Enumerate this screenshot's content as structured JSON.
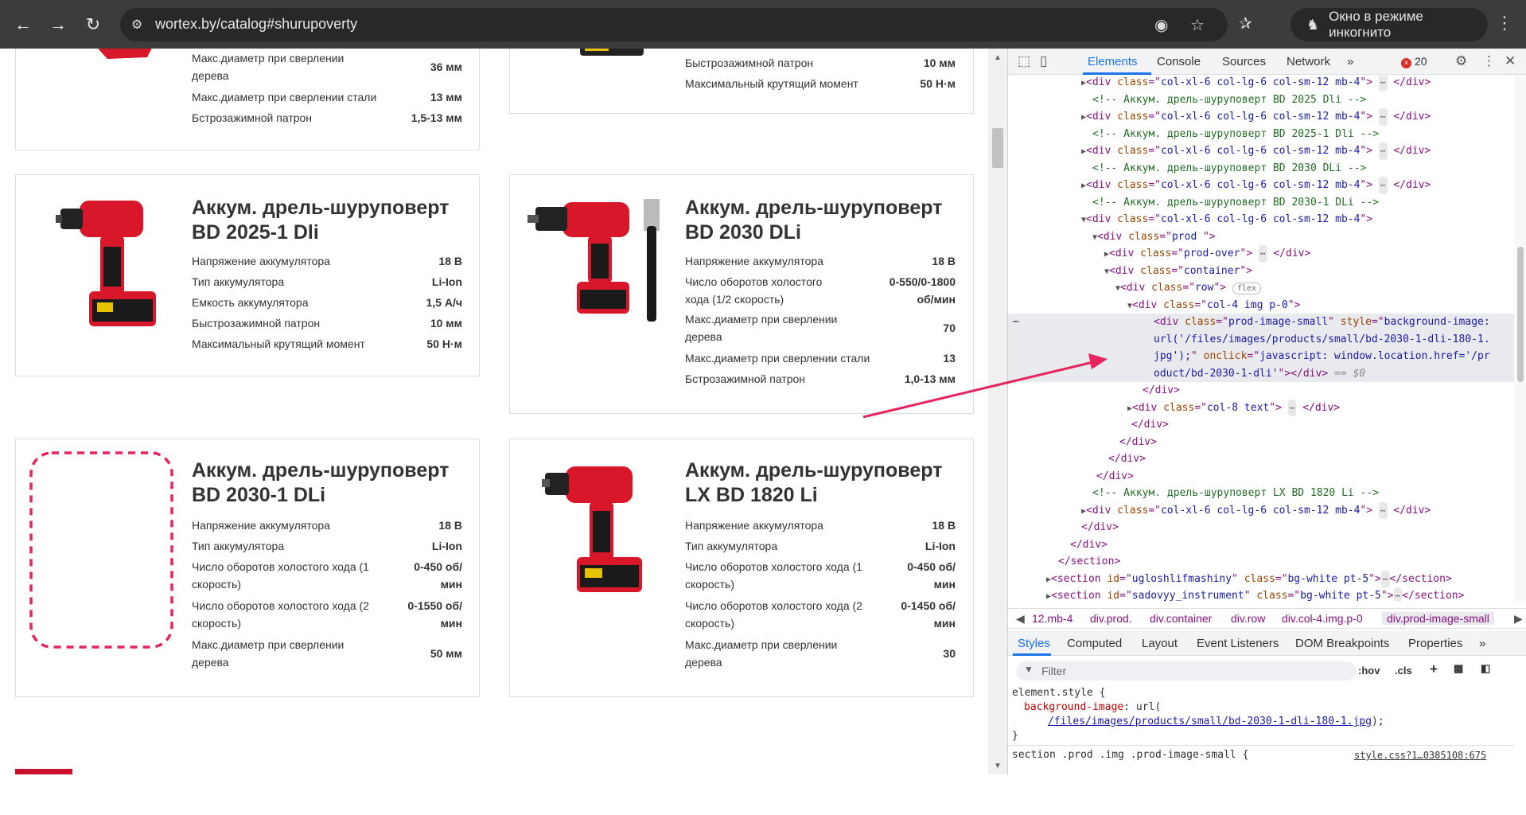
{
  "browser": {
    "url": "wortex.by/catalog#shurupoverty",
    "incognito_label": "Окно в режиме инкогнито",
    "error_count": "20"
  },
  "products": {
    "top_left": {
      "specs": [
        {
          "k": "Макс.диаметр при сверлении дерева",
          "v": "36 мм"
        },
        {
          "k": "Макс.диаметр при сверлении стали",
          "v": "13 мм"
        },
        {
          "k": "Бстрозажимной патрон",
          "v": "1,5-13 мм"
        }
      ]
    },
    "top_right": {
      "specs": [
        {
          "k": "Быстрозажимной патрон",
          "v": "10 мм"
        },
        {
          "k": "Максимальный крутящий момент",
          "v": "50 Н·м"
        }
      ]
    },
    "bd2025": {
      "title1": "Аккум. дрель-шуруповерт",
      "title2": "BD 2025-1 Dli",
      "specs": [
        {
          "k": "Напряжение аккумулятора",
          "v": "18 В"
        },
        {
          "k": "Тип аккумулятора",
          "v": "Li-Ion"
        },
        {
          "k": "Емкость аккумулятора",
          "v": "1,5 А/ч"
        },
        {
          "k": "Быстрозажимной патрон",
          "v": "10 мм"
        },
        {
          "k": "Максимальный крутящий момент",
          "v": "50 Н·м"
        }
      ]
    },
    "bd2030": {
      "title1": "Аккум. дрель-шуруповерт",
      "title2": "BD 2030 DLi",
      "specs": [
        {
          "k": "Напряжение аккумулятора",
          "v": "18 В"
        },
        {
          "k": "Число оборотов холостого хода (1/2 скорость)",
          "v": "0-550/0-1800 об/мин"
        },
        {
          "k": "Макс.диаметр при сверлении дерева",
          "v": "70"
        },
        {
          "k": "Макс.диаметр при сверлении стали",
          "v": "13"
        },
        {
          "k": "Бстрозажимной патрон",
          "v": "1,0-13 мм"
        }
      ]
    },
    "bd2030_1": {
      "title1": "Аккум. дрель-шуруповерт",
      "title2": "BD 2030-1 DLi",
      "specs": [
        {
          "k": "Напряжение аккумулятора",
          "v": "18 В"
        },
        {
          "k": "Тип аккумулятора",
          "v": "Li-Ion"
        },
        {
          "k": "Число оборотов холостого хода (1 скорость)",
          "v": "0-450 об/мин"
        },
        {
          "k": "Число оборотов холостого хода (2 скорость)",
          "v": "0-1550 об/мин"
        },
        {
          "k": "Макс.диаметр при сверлении дерева",
          "v": "50 мм"
        }
      ]
    },
    "lx1820": {
      "title1": "Аккум. дрель-шуруповерт",
      "title2": "LX BD 1820 Li",
      "specs": [
        {
          "k": "Напряжение аккумулятора",
          "v": "18 В"
        },
        {
          "k": "Тип аккумулятора",
          "v": "Li-Ion"
        },
        {
          "k": "Число оборотов холостого хода (1 скорость)",
          "v": "0-450 об/мин"
        },
        {
          "k": "Число оборотов холостого хода (2 скорость)",
          "v": "0-1450 об/мин"
        },
        {
          "k": "Макс.диаметр при сверлении дерева",
          "v": "30"
        }
      ]
    }
  },
  "devtools": {
    "tabs": [
      "Elements",
      "Console",
      "Sources",
      "Network"
    ],
    "breadcrumbs": [
      "12.mb-4",
      "div.prod.",
      "div.container",
      "div.row",
      "div.col-4.img.p-0",
      "div.prod-image-small"
    ],
    "subtabs": [
      "Styles",
      "Computed",
      "Layout",
      "Event Listeners",
      "DOM Breakpoints",
      "Properties"
    ],
    "filter_placeholder": "Filter",
    "filter_hov": ":hov",
    "filter_cls": ".cls",
    "dom": {
      "col_class": "col-xl-6 col-lg-6 col-sm-12 mb-4",
      "cm_2025": " Аккум. дрель-шуруповерт BD 2025 Dli ",
      "cm_2025_1": " Аккум. дрель-шуруповерт BD 2025-1 Dli ",
      "cm_2030": " Аккум. дрель-шуруповерт BD 2030 DLi ",
      "cm_2030_1": " Аккум. дрель-шуруповерт BD 2030-1 DLi ",
      "cm_lx": " Аккум. дрель-шуруповерт LX BD 1820 Li ",
      "prod": "prod ",
      "prod_over": "prod-over",
      "container": "container",
      "row": "row",
      "flex_badge": "flex",
      "col4": "col-4 img p-0",
      "pis_class": "prod-image-small",
      "pis_style_1": "background-image: ",
      "pis_style_2": "url('/files/images/products/small/bd-2030-1-dli-180-1.",
      "pis_style_3": "jpg');",
      "pis_onclick_1": "javascript: window.location.href='/pr",
      "pis_onclick_2": "oduct/bd-2030-1-dli'",
      "eq0": "== $0",
      "col8": "col-8 text",
      "sec1_id": "ugloshlifmashiny",
      "sec1_class": "bg-white pt-5",
      "sec2_id": "sadovyy_instrument",
      "sec2_class": "bg-white pt-5"
    },
    "css": {
      "element_style": "element.style {",
      "prop": "background-image",
      "url_fn": "url(",
      "url_link": "/files/images/products/small/bd-2030-1-dli-180-1.jpg",
      "url_close": ");",
      "close": "}",
      "rule2": "section .prod .img .prod-image-small {",
      "source": "style.css?1…0385108:675"
    }
  },
  "colors": {
    "annotation": "#e8245e",
    "chrome_bar": "#3c3c3c",
    "devtools_accent": "#1a73e8"
  }
}
